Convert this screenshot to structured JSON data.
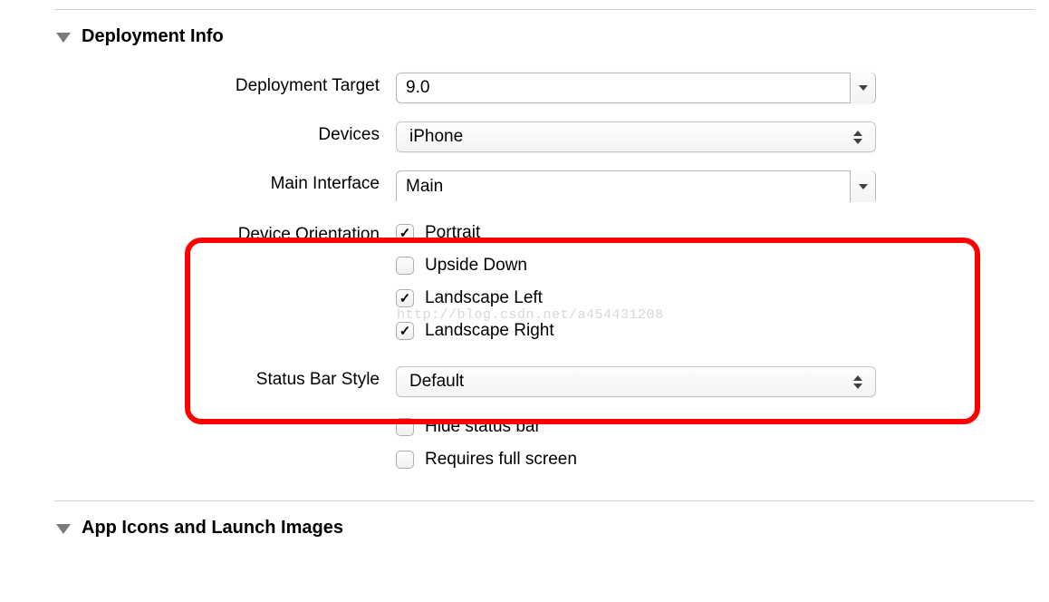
{
  "sections": {
    "deployment": {
      "title": "Deployment Info",
      "target_label": "Deployment Target",
      "target_value": "9.0",
      "devices_label": "Devices",
      "devices_value": "iPhone",
      "main_interface_label": "Main Interface",
      "main_interface_value": "Main",
      "orientation_label": "Device Orientation",
      "orientation_options": {
        "portrait": "Portrait",
        "upside_down": "Upside Down",
        "landscape_left": "Landscape Left",
        "landscape_right": "Landscape Right"
      },
      "status_bar_label": "Status Bar Style",
      "status_bar_value": "Default",
      "hide_status_bar": "Hide status bar",
      "requires_full_screen": "Requires full screen"
    },
    "app_icons": {
      "title": "App Icons and Launch Images"
    }
  },
  "watermark": "http://blog.csdn.net/a454431208"
}
